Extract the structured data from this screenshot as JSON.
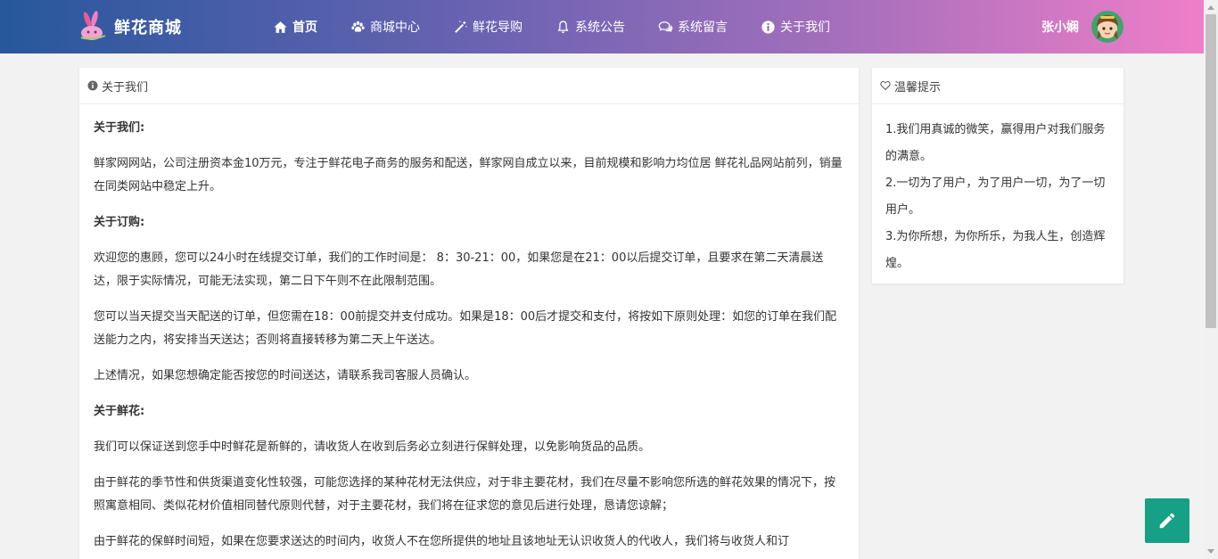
{
  "brand": {
    "name": "鲜花商城",
    "logo_icon": "bunny-logo-icon"
  },
  "nav": [
    {
      "label": "首页",
      "icon": "home-icon"
    },
    {
      "label": "商城中心",
      "icon": "paw-icon"
    },
    {
      "label": "鲜花导购",
      "icon": "magic-wand-icon"
    },
    {
      "label": "系统公告",
      "icon": "bell-icon"
    },
    {
      "label": "系统留言",
      "icon": "comments-icon"
    },
    {
      "label": "关于我们",
      "icon": "info-circle-icon"
    }
  ],
  "user": {
    "name": "张小娴"
  },
  "main": {
    "title": "关于我们",
    "sections": [
      {
        "heading": "关于我们:",
        "paragraphs": [
          "鲜家网网站，公司注册资本金10万元，专注于鲜花电子商务的服务和配送，鲜家网自成立以来，目前规模和影响力均位居 鲜花礼品网站前列，销量在同类网站中稳定上升。"
        ]
      },
      {
        "heading": "关于订购:",
        "paragraphs": [
          "欢迎您的惠顾，您可以24小时在线提交订单，我们的工作时间是： 8：30-21：00，如果您是在21：00以后提交订单，且要求在第二天清晨送达，限于实际情况，可能无法实现，第二日下午则不在此限制范围。",
          "您可以当天提交当天配送的订单，但您需在18：00前提交并支付成功。如果是18：00后才提交和支付，将按如下原则处理：如您的订单在我们配送能力之内，将安排当天送达；否则将直接转移为第二天上午送达。",
          "上述情况，如果您想确定能否按您的时间送达，请联系我司客服人员确认。"
        ]
      },
      {
        "heading": "关于鲜花:",
        "paragraphs": [
          "我们可以保证送到您手中时鲜花是新鲜的，请收货人在收到后务必立刻进行保鲜处理，以免影响货品的品质。",
          "由于鲜花的季节性和供货渠道变化性较强，可能您选择的某种花材无法供应，对于非主要花材，我们在尽量不影响您所选的鲜花效果的情况下，按照寓意相同、类似花材价值相同替代原则代替，对于主要花材，我们将在征求您的意见后进行处理，恳请您谅解；",
          "由于鲜花的保鲜时间短，如果在您要求送达的时间内，收货人不在您所提供的地址且该地址无认识收货人的代收人，我们将与收货人和订"
        ]
      }
    ]
  },
  "tips": {
    "title": "温馨提示",
    "items": [
      "1.我们用真诚的微笑，赢得用户对我们服务的满意。",
      "2.一切为了用户，为了用户一切，为了一切用户。",
      "3.为你所想，为你所乐，为我人生，创造辉煌。"
    ]
  },
  "fab": {
    "icon": "pencil-icon"
  },
  "colors": {
    "accent": "#16a085",
    "nav_start": "#27589c",
    "nav_end": "#f07ec8"
  }
}
